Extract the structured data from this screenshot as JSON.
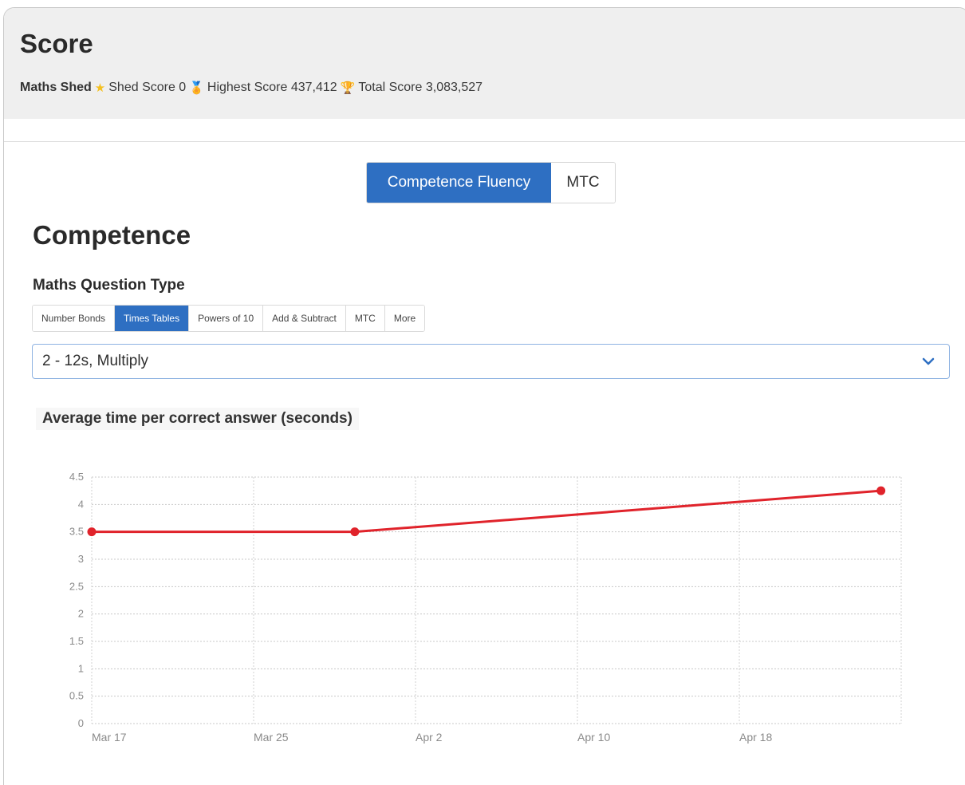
{
  "score": {
    "title": "Score",
    "brand": "Maths Shed",
    "shed_score": "Shed Score 0",
    "highest_score": "Highest Score 437,412",
    "total_score": "Total Score 3,083,527",
    "icons": [
      "star-icon",
      "medal-icon",
      "trophy-icon"
    ]
  },
  "view_toggle": {
    "options": [
      "Competence Fluency",
      "MTC"
    ],
    "selected": "Competence Fluency"
  },
  "competence": {
    "title": "Competence",
    "question_type_label": "Maths Question Type",
    "question_tabs": [
      "Number Bonds",
      "Times Tables",
      "Powers of 10",
      "Add & Subtract",
      "MTC",
      "More"
    ],
    "selected_tab": "Times Tables",
    "select_value": "2 - 12s, Multiply"
  },
  "colors": {
    "accent": "#2e6fc2",
    "series": "#e0232b",
    "header_bg": "#efefef"
  },
  "chart_data": {
    "type": "line",
    "title": "Average time per correct answer (seconds)",
    "xlabel": "",
    "ylabel": "",
    "x_ticks": [
      "Mar 17",
      "Mar 25",
      "Apr 2",
      "Apr 10",
      "Apr 18"
    ],
    "y_ticks": [
      "0",
      "0.5",
      "1",
      "1.5",
      "2",
      "2.5",
      "3",
      "3.5",
      "4",
      "4.5"
    ],
    "ylim": [
      0,
      4.5
    ],
    "grid": true,
    "series": [
      {
        "x": [
          "Mar 17",
          "Mar 30",
          "Apr 25"
        ],
        "y": [
          3.5,
          3.5,
          4.25
        ],
        "color": "#e0232b"
      }
    ]
  }
}
